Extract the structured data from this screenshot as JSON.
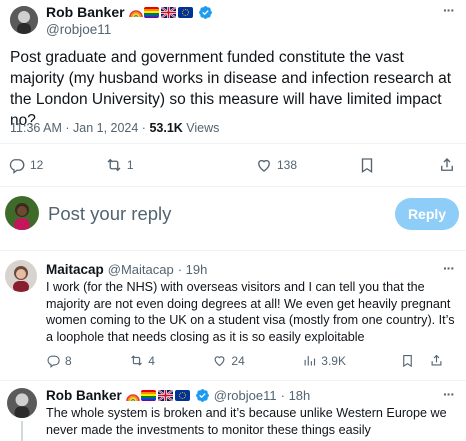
{
  "main_tweet": {
    "author_name": "Rob Banker",
    "handle": "@robjoe11",
    "text": "Post graduate and government funded constitute the vast majority (my husband works in disease and infection research at the London University) so this measure will have limited impact no?",
    "time": "11:36 AM · Jan 1, 2024 ·",
    "views_count": "53.1K",
    "views_label": "Views",
    "replies": "12",
    "retweets": "1",
    "likes": "138",
    "more": "···"
  },
  "composer": {
    "placeholder": "Post your reply",
    "reply_label": "Reply"
  },
  "reply1": {
    "author_name": "Maitacap",
    "handle": "@Maitacap",
    "age": "· 19h",
    "text": "I work (for the NHS) with overseas visitors and I can tell you that the majority are not even doing degrees at all! We even get heavily pregnant women coming to the UK on a student visa (mostly from one country). It’s a loophole that needs closing as it is so easily exploitable",
    "replies": "8",
    "retweets": "4",
    "likes": "24",
    "views": "3.9K",
    "more": "···"
  },
  "reply2": {
    "author_name": "Rob Banker",
    "handle": "@robjoe11",
    "age": "· 18h",
    "text": "The whole system is broken and it’s because unlike Western Europe we never made the investments to monitor these things easily",
    "more": "···"
  },
  "colors": {
    "accent": "#1d9bf0",
    "reply_button": "#8ecdf7",
    "muted": "#536471",
    "divider": "#eff3f4"
  }
}
